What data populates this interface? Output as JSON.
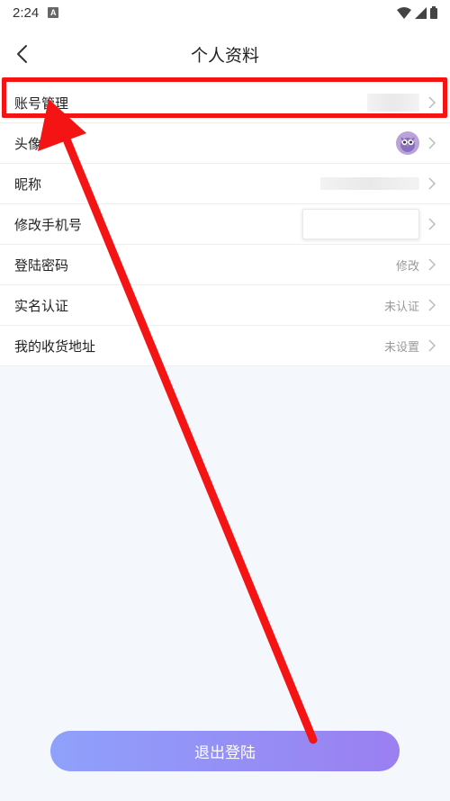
{
  "status_bar": {
    "time": "2:24",
    "badge": "A"
  },
  "header": {
    "title": "个人资料"
  },
  "rows": [
    {
      "label": "账号管理",
      "value": ""
    },
    {
      "label": "头像",
      "value": ""
    },
    {
      "label": "昵称",
      "value": ""
    },
    {
      "label": "修改手机号",
      "value": ""
    },
    {
      "label": "登陆密码",
      "value": "修改"
    },
    {
      "label": "实名认证",
      "value": "未认证"
    },
    {
      "label": "我的收货地址",
      "value": "未设置"
    }
  ],
  "logout": {
    "label": "退出登陆"
  },
  "icons": {
    "back": "chevron-left-icon",
    "chevron": "chevron-right-icon",
    "wifi": "wifi-icon",
    "signal": "signal-icon",
    "battery": "battery-icon",
    "avatar": "owl-avatar"
  },
  "colors": {
    "accent_start": "#8fa1fb",
    "accent_end": "#9a7ff1",
    "annotation": "#f51414",
    "page_background": "#f4f8fd"
  }
}
